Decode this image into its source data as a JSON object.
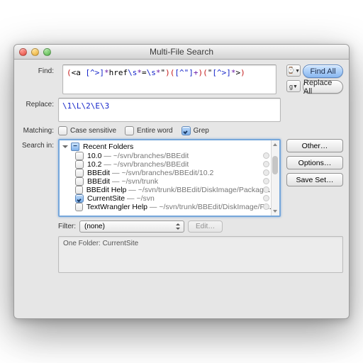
{
  "window": {
    "title": "Multi-File Search"
  },
  "labels": {
    "find": "Find:",
    "replace": "Replace:",
    "matching": "Matching:",
    "search_in": "Search in:",
    "filter": "Filter:"
  },
  "find": {
    "segments": [
      {
        "cls": "c-red",
        "t": "("
      },
      {
        "cls": "c-blk",
        "t": "<a "
      },
      {
        "cls": "c-blue",
        "t": "[^>]"
      },
      {
        "cls": "c-pur",
        "t": "*"
      },
      {
        "cls": "c-blk",
        "t": "href"
      },
      {
        "cls": "c-blue",
        "t": "\\s"
      },
      {
        "cls": "c-pur",
        "t": "*"
      },
      {
        "cls": "c-blk",
        "t": "="
      },
      {
        "cls": "c-blue",
        "t": "\\s"
      },
      {
        "cls": "c-pur",
        "t": "*"
      },
      {
        "cls": "c-blk",
        "t": "\""
      },
      {
        "cls": "c-red",
        "t": ")"
      },
      {
        "cls": "c-red",
        "t": "("
      },
      {
        "cls": "c-blue",
        "t": "[^\"]"
      },
      {
        "cls": "c-pur",
        "t": "+"
      },
      {
        "cls": "c-red",
        "t": ")"
      },
      {
        "cls": "c-red",
        "t": "("
      },
      {
        "cls": "c-blk",
        "t": "\""
      },
      {
        "cls": "c-blue",
        "t": "[^>]"
      },
      {
        "cls": "c-pur",
        "t": "*"
      },
      {
        "cls": "c-blk",
        "t": ">"
      },
      {
        "cls": "c-red",
        "t": ")"
      }
    ]
  },
  "replace": {
    "text": "\\1\\L\\2\\E\\3"
  },
  "matching": {
    "case_sensitive": {
      "label": "Case sensitive",
      "checked": false
    },
    "entire_word": {
      "label": "Entire word",
      "checked": false
    },
    "grep": {
      "label": "Grep",
      "checked": true
    }
  },
  "buttons": {
    "find_all": "Find All",
    "replace_all": "Replace All",
    "other": "Other…",
    "options": "Options…",
    "save_set": "Save Set…",
    "edit": "Edit…",
    "history_icon": "⌚",
    "grep_icon": "g"
  },
  "tree": {
    "header": "Recent Folders",
    "items": [
      {
        "name": "10.0",
        "path": "~/svn/branches/BBEdit",
        "checked": false
      },
      {
        "name": "10.2",
        "path": "~/svn/branches/BBEdit",
        "checked": false
      },
      {
        "name": "BBEdit",
        "path": "~/svn/branches/BBEdit/10.2",
        "checked": false
      },
      {
        "name": "BBEdit",
        "path": "~/svn/trunk",
        "checked": false
      },
      {
        "name": "BBEdit Help",
        "path": "~/svn/trunk/BBEdit/DiskImage/PackageCompon…",
        "checked": false
      },
      {
        "name": "CurrentSite",
        "path": "~/svn",
        "checked": true
      },
      {
        "name": "TextWrangler Help",
        "path": "~/svn/trunk/BBEdit/DiskImage/PackageC…",
        "checked": false
      }
    ]
  },
  "filter": {
    "value": "(none)"
  },
  "summary": {
    "text": "One Folder: CurrentSite"
  }
}
